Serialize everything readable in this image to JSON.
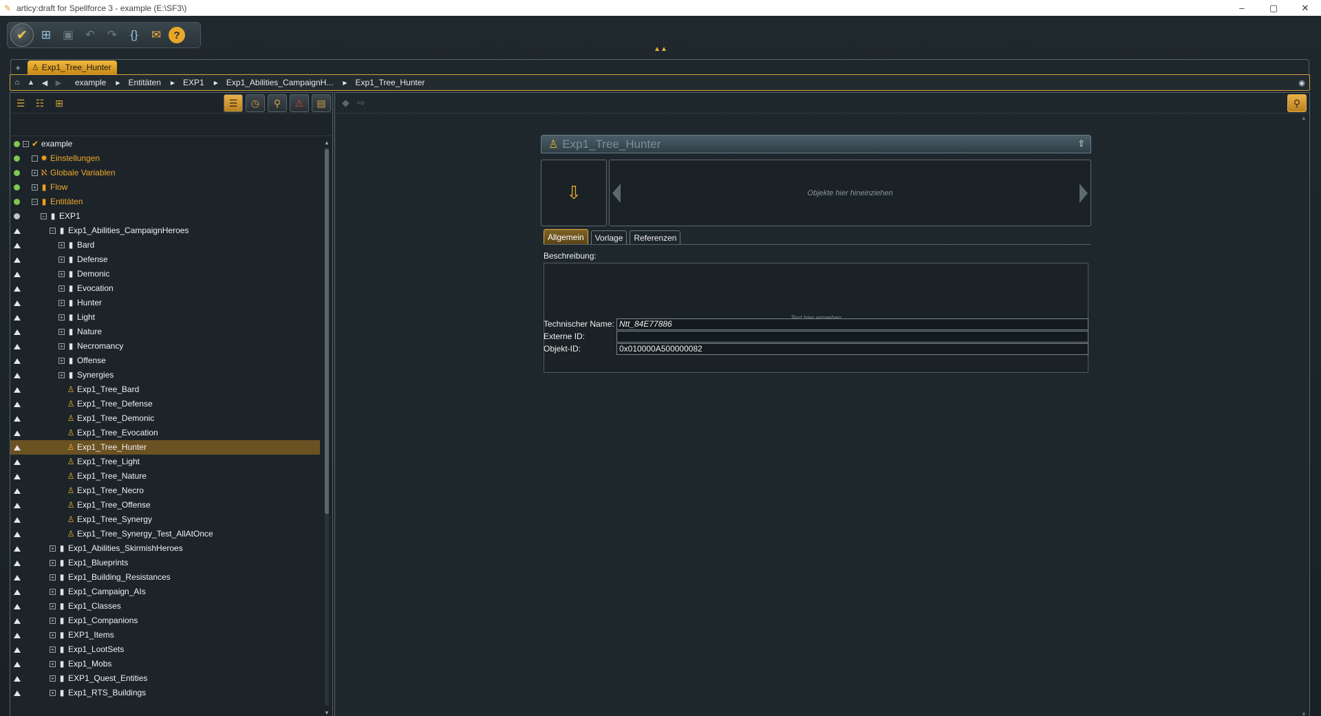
{
  "window": {
    "title": "articy:draft for Spellforce 3 - example (E:\\SF3\\)",
    "controls": [
      "–",
      "▢",
      "✕"
    ]
  },
  "toolbar": {
    "buttons": [
      "main-menu",
      "new-object",
      "save",
      "undo",
      "redo",
      "sync",
      "mail",
      "help"
    ]
  },
  "tabs": [
    {
      "label": "Exp1_Tree_Hunter"
    }
  ],
  "breadcrumb": [
    "example",
    "Entitäten",
    "EXP1",
    "Exp1_Abilities_CampaignH...",
    "Exp1_Tree_Hunter"
  ],
  "tree": [
    {
      "label": "example",
      "status": "dot",
      "depth": 0,
      "expander": "−",
      "icon": "check",
      "orange": false
    },
    {
      "label": "Einstellungen",
      "status": "dot",
      "depth": 1,
      "expander": "",
      "icon": "gear",
      "orange": true
    },
    {
      "label": "Globale Variablen",
      "status": "dot",
      "depth": 1,
      "expander": "+",
      "icon": "var",
      "orange": true
    },
    {
      "label": "Flow",
      "status": "dot",
      "depth": 1,
      "expander": "+",
      "icon": "flow",
      "orange": true
    },
    {
      "label": "Entitäten",
      "status": "dot",
      "depth": 1,
      "expander": "−",
      "icon": "ent",
      "orange": true
    },
    {
      "label": "EXP1",
      "status": "grey",
      "depth": 2,
      "expander": "−",
      "icon": "folder",
      "orange": false
    },
    {
      "label": "Exp1_Abilities_CampaignHeroes",
      "status": "arrow",
      "depth": 3,
      "expander": "−",
      "icon": "folder",
      "orange": false
    },
    {
      "label": "Bard",
      "status": "arrow",
      "depth": 4,
      "expander": "+",
      "icon": "folder",
      "orange": false
    },
    {
      "label": "Defense",
      "status": "arrow",
      "depth": 4,
      "expander": "+",
      "icon": "folder",
      "orange": false
    },
    {
      "label": "Demonic",
      "status": "arrow",
      "depth": 4,
      "expander": "+",
      "icon": "folder",
      "orange": false
    },
    {
      "label": "Evocation",
      "status": "arrow",
      "depth": 4,
      "expander": "+",
      "icon": "folder",
      "orange": false
    },
    {
      "label": "Hunter",
      "status": "arrow",
      "depth": 4,
      "expander": "+",
      "icon": "folder",
      "orange": false
    },
    {
      "label": "Light",
      "status": "arrow",
      "depth": 4,
      "expander": "+",
      "icon": "folder",
      "orange": false
    },
    {
      "label": "Nature",
      "status": "arrow",
      "depth": 4,
      "expander": "+",
      "icon": "folder",
      "orange": false
    },
    {
      "label": "Necromancy",
      "status": "arrow",
      "depth": 4,
      "expander": "+",
      "icon": "folder",
      "orange": false
    },
    {
      "label": "Offense",
      "status": "arrow",
      "depth": 4,
      "expander": "+",
      "icon": "folder",
      "orange": false
    },
    {
      "label": "Synergies",
      "status": "arrow",
      "depth": 4,
      "expander": "+",
      "icon": "folder",
      "orange": false
    },
    {
      "label": "Exp1_Tree_Bard",
      "status": "arrow",
      "depth": 4,
      "expander": "",
      "icon": "entity",
      "orange": false
    },
    {
      "label": "Exp1_Tree_Defense",
      "status": "arrow",
      "depth": 4,
      "expander": "",
      "icon": "entity",
      "orange": false
    },
    {
      "label": "Exp1_Tree_Demonic",
      "status": "arrow",
      "depth": 4,
      "expander": "",
      "icon": "entity",
      "orange": false
    },
    {
      "label": "Exp1_Tree_Evocation",
      "status": "arrow",
      "depth": 4,
      "expander": "",
      "icon": "entity",
      "orange": false
    },
    {
      "label": "Exp1_Tree_Hunter",
      "status": "arrow",
      "depth": 4,
      "expander": "",
      "icon": "entity",
      "orange": false,
      "selected": true
    },
    {
      "label": "Exp1_Tree_Light",
      "status": "arrow",
      "depth": 4,
      "expander": "",
      "icon": "entity",
      "orange": false
    },
    {
      "label": "Exp1_Tree_Nature",
      "status": "arrow",
      "depth": 4,
      "expander": "",
      "icon": "entity",
      "orange": false
    },
    {
      "label": "Exp1_Tree_Necro",
      "status": "arrow",
      "depth": 4,
      "expander": "",
      "icon": "entity",
      "orange": false
    },
    {
      "label": "Exp1_Tree_Offense",
      "status": "arrow",
      "depth": 4,
      "expander": "",
      "icon": "entity",
      "orange": false
    },
    {
      "label": "Exp1_Tree_Synergy",
      "status": "arrow",
      "depth": 4,
      "expander": "",
      "icon": "entity",
      "orange": false
    },
    {
      "label": "Exp1_Tree_Synergy_Test_AllAtOnce",
      "status": "arrow",
      "depth": 4,
      "expander": "",
      "icon": "entity",
      "orange": false
    },
    {
      "label": "Exp1_Abilities_SkirmishHeroes",
      "status": "arrow",
      "depth": 3,
      "expander": "+",
      "icon": "folder",
      "orange": false
    },
    {
      "label": "Exp1_Blueprints",
      "status": "arrow",
      "depth": 3,
      "expander": "+",
      "icon": "folder",
      "orange": false
    },
    {
      "label": "Exp1_Building_Resistances",
      "status": "arrow",
      "depth": 3,
      "expander": "+",
      "icon": "folder",
      "orange": false
    },
    {
      "label": "Exp1_Campaign_AIs",
      "status": "arrow",
      "depth": 3,
      "expander": "+",
      "icon": "folder",
      "orange": false
    },
    {
      "label": "Exp1_Classes",
      "status": "arrow",
      "depth": 3,
      "expander": "+",
      "icon": "folder",
      "orange": false
    },
    {
      "label": "Exp1_Companions",
      "status": "arrow",
      "depth": 3,
      "expander": "+",
      "icon": "folder",
      "orange": false
    },
    {
      "label": "EXP1_Items",
      "status": "arrow",
      "depth": 3,
      "expander": "+",
      "icon": "folder",
      "orange": false
    },
    {
      "label": "Exp1_LootSets",
      "status": "arrow",
      "depth": 3,
      "expander": "+",
      "icon": "folder",
      "orange": false
    },
    {
      "label": "Exp1_Mobs",
      "status": "arrow",
      "depth": 3,
      "expander": "+",
      "icon": "folder",
      "orange": false
    },
    {
      "label": "EXP1_Quest_Entities",
      "status": "arrow",
      "depth": 3,
      "expander": "+",
      "icon": "folder",
      "orange": false
    },
    {
      "label": "Exp1_RTS_Buildings",
      "status": "arrow",
      "depth": 3,
      "expander": "+",
      "icon": "folder",
      "orange": false
    }
  ],
  "editor": {
    "title": "Exp1_Tree_Hunter",
    "drop_hint": "Objekte hier hineinziehen",
    "tabs": [
      "Allgemein",
      "Vorlage",
      "Referenzen"
    ],
    "description_label": "Beschreibung:",
    "description_placeholder": "Text hier eingeben",
    "fields": [
      {
        "label": "Technischer Name:",
        "value": "Ntt_84E77886",
        "italic": true
      },
      {
        "label": "Externe ID:",
        "value": "",
        "italic": false
      },
      {
        "label": "Objekt-ID:",
        "value": "0x010000A500000082",
        "italic": false
      }
    ]
  },
  "colors": {
    "accent": "#f0b02a",
    "selection": "#6b5223",
    "status_green": "#7ec850",
    "background": "#1b2227"
  }
}
